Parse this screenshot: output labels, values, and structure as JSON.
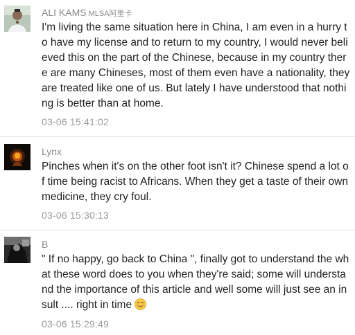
{
  "comments": [
    {
      "author": "ALI KAMS",
      "author_suffix": "MLSA阿里卡",
      "text": "I'm living the same situation here in China, I am even in a hurry to have my license and to return to my country, I would never believed this on the part of the Chinese, because in my country there are many Chineses, most of them even have a nationality, they are treated like one of us. But lately I have understood that nothing is better than at home.",
      "time": "03-06 15:41:02",
      "avatar_icon": "person-photo-avatar"
    },
    {
      "author": "Lynx",
      "text": "Pinches when it's on the other foot isn't it? Chinese spend a lot of time being racist to Africans. When they get a taste of their own medicine, they cry foul.",
      "time": "03-06 15:30:13",
      "avatar_icon": "glowing-figure-avatar"
    },
    {
      "author": "B",
      "text": "\" If no happy, go back to China \", finally got to understand the what these word does to you when they're said; some will understand the importance of this article and well some will just see an insult .... right in time",
      "time": "03-06 15:29:49",
      "avatar_icon": "dark-photo-avatar",
      "trailing_emoji": "smiling-face-emoji"
    }
  ],
  "colors": {
    "author": "#8a8a8a",
    "text": "#1f1f1f",
    "time": "#9a9a9a",
    "divider": "#e6e6e6"
  }
}
